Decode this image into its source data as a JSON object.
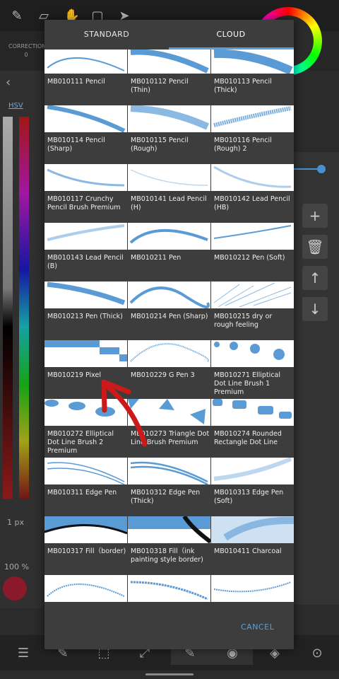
{
  "dialog": {
    "tabs": [
      "STANDARD",
      "CLOUD"
    ],
    "active_tab": "CLOUD",
    "cancel_label": "CANCEL",
    "brushes": [
      "MB010111 Pencil",
      "MB010112 Pencil (Thin)",
      "MB010113 Pencil (Thick)",
      "MB010114 Pencil (Sharp)",
      "MB010115 Pencil (Rough)",
      "MB010116 Pencil (Rough) 2",
      "MB010117 Crunchy Pencil Brush Premium",
      "MB010141 Lead Pencil (H)",
      "MB010142 Lead Pencil (HB)",
      "MB010143 Lead Pencil (B)",
      "MB010211 Pen",
      "MB010212 Pen (Soft)",
      "MB010213 Pen (Thick)",
      "MB010214 Pen (Sharp)",
      "MB010215 dry or rough feeling",
      "MB010219 Pixel",
      "MB010229 G Pen 3",
      "MB010271 Elliptical Dot Line Brush 1 Premium",
      "MB010272 Elliptical Dot Line Brush 2 Premium",
      "MB010273 Triangle Dot Line Brush Premium",
      "MB010274 Rounded Rectangle Dot Line",
      "MB010311 Edge Pen",
      "MB010312 Edge Pen (Thick)",
      "MB010313 Edge Pen (Soft)",
      "MB010317 Fill（border)",
      "MB010318 Fill（ink painting style border)",
      "MB010411 Charcoal",
      "",
      "",
      ""
    ]
  },
  "background": {
    "correction_label": "CORRECTION",
    "correction_value": "0",
    "hsv_label": "HSV",
    "size_label": "1 px",
    "opacity_label": "100 %"
  },
  "colors": {
    "accent": "#5aa0d8",
    "dialog_bg": "#3d3d3d",
    "stroke": "#5b9bd5",
    "annotation_arrow": "#cc1a1a"
  }
}
